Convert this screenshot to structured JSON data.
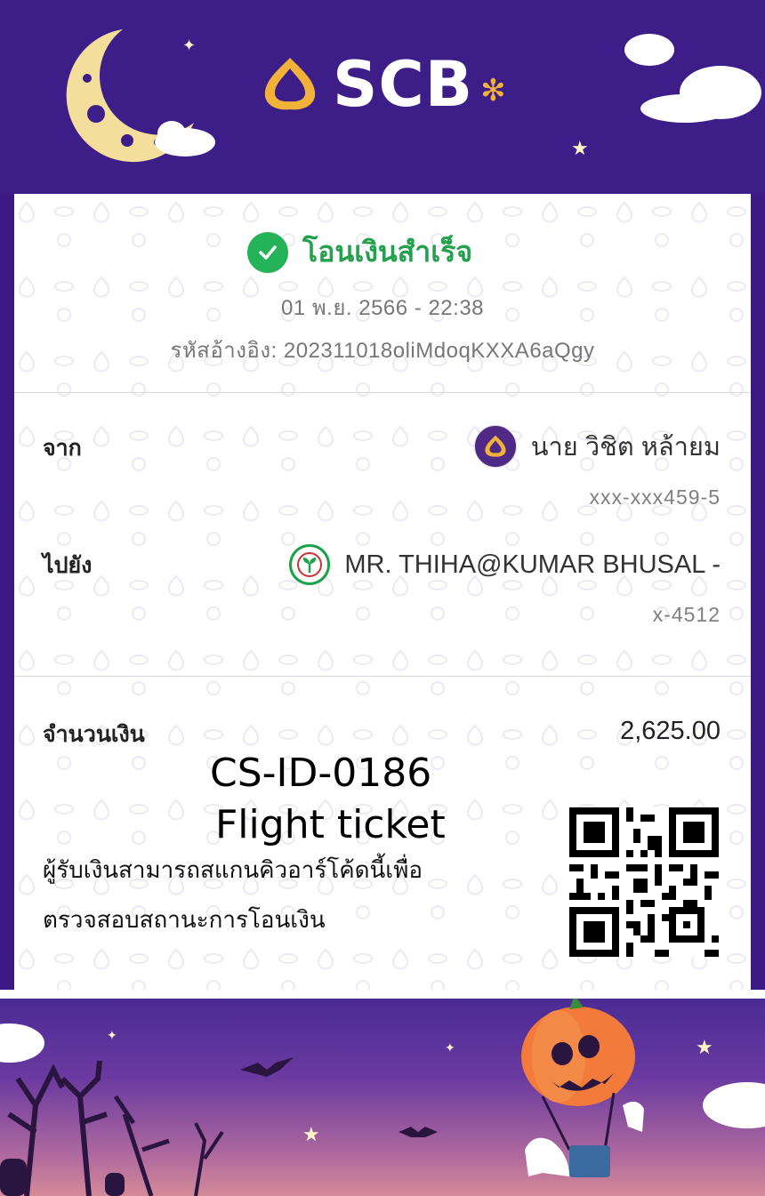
{
  "header": {
    "brand": "SCB"
  },
  "status": {
    "title": "โอนเงินสำเร็จ",
    "datetime": "01 พ.ย. 2566 - 22:38",
    "reference": "รหัสอ้างอิง: 202311018oliMdoqKXXA6aQgy"
  },
  "sender": {
    "label": "จาก",
    "name": "นาย วิชิต หล้ายม",
    "account": "xxx-xxx459-5",
    "bank_icon": "scb-bank-icon"
  },
  "receiver": {
    "label": "ไปยัง",
    "name": "MR. THIHA@KUMAR BHUSAL -",
    "account": "x-4512",
    "bank_icon": "kbank-bank-icon"
  },
  "amount": {
    "label": "จำนวนเงิน",
    "value": "2,625.00"
  },
  "overlay_note": {
    "line1": "CS-ID-0186",
    "line2": "Flight ticket"
  },
  "qr_section": {
    "line1": "ผู้รับเงินสามารถสแกนคิวอาร์โค้ดนี้เพื่อ",
    "line2": "ตรวจสอบสถานะการโอนเงิน"
  },
  "colors": {
    "brand_purple": "#3d1e88",
    "success_green": "#25b35a",
    "scb_gold": "#f2b23a"
  }
}
